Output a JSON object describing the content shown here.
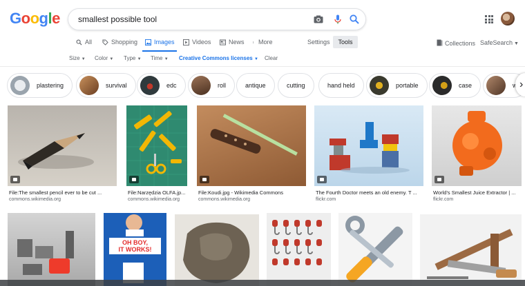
{
  "header": {
    "logo_letters": [
      "G",
      "o",
      "o",
      "g",
      "l",
      "e"
    ],
    "logo_colors": [
      "#4285F4",
      "#EA4335",
      "#FBBC05",
      "#4285F4",
      "#34A853",
      "#EA4335"
    ],
    "query": "smallest possible tool"
  },
  "tabs": [
    {
      "label": "All",
      "icon": "search-icon"
    },
    {
      "label": "Shopping",
      "icon": "tag-icon"
    },
    {
      "label": "Images",
      "icon": "image-icon",
      "active": true
    },
    {
      "label": "Videos",
      "icon": "play-icon"
    },
    {
      "label": "News",
      "icon": "newspaper-icon"
    },
    {
      "label": "More",
      "icon": "more-icon"
    }
  ],
  "settings_label": "Settings",
  "tools_label": "Tools",
  "collections_label": "Collections",
  "safesearch_label": "SafeSearch",
  "filters": {
    "size": "Size",
    "color": "Color",
    "type": "Type",
    "time": "Time",
    "license": "Creative Commons licenses",
    "clear": "Clear"
  },
  "chips": [
    {
      "label": "plastering",
      "thumb_color": "#9aa4ad"
    },
    {
      "label": "survival",
      "thumb_color": "#a36b3f"
    },
    {
      "label": "edc",
      "thumb_color": "#2f3a3d"
    },
    {
      "label": "roll",
      "thumb_color": "#6a4a35"
    },
    {
      "label": "antique"
    },
    {
      "label": "cutting"
    },
    {
      "label": "hand held"
    },
    {
      "label": "portable",
      "thumb_color": "#3a3a2e"
    },
    {
      "label": "case",
      "thumb_color": "#2b2b2b"
    },
    {
      "label": "w",
      "thumb_color": "#7a5b46"
    }
  ],
  "results_row1": [
    {
      "caption": "File:The smallest pencil ever to be cut ...",
      "source": "commons.wikimedia.org"
    },
    {
      "caption": "File:Narzędzia OLFA.jp...",
      "source": "commons.wikimedia.org"
    },
    {
      "caption": "File:Koudi.jpg - Wikimedia Commons",
      "source": "commons.wikimedia.org"
    },
    {
      "caption": "The Fourth Doctor meets an old enemy. T ...",
      "source": "flickr.com"
    },
    {
      "caption": "World's Smallest Juice Extractor | ...",
      "source": "flickr.com"
    }
  ],
  "results_row2_text": {
    "sign_line1": "OH BOY,",
    "sign_line2": "IT WORKS!"
  },
  "colors": {
    "accent": "#1a73e8",
    "text_secondary": "#5f6368"
  }
}
